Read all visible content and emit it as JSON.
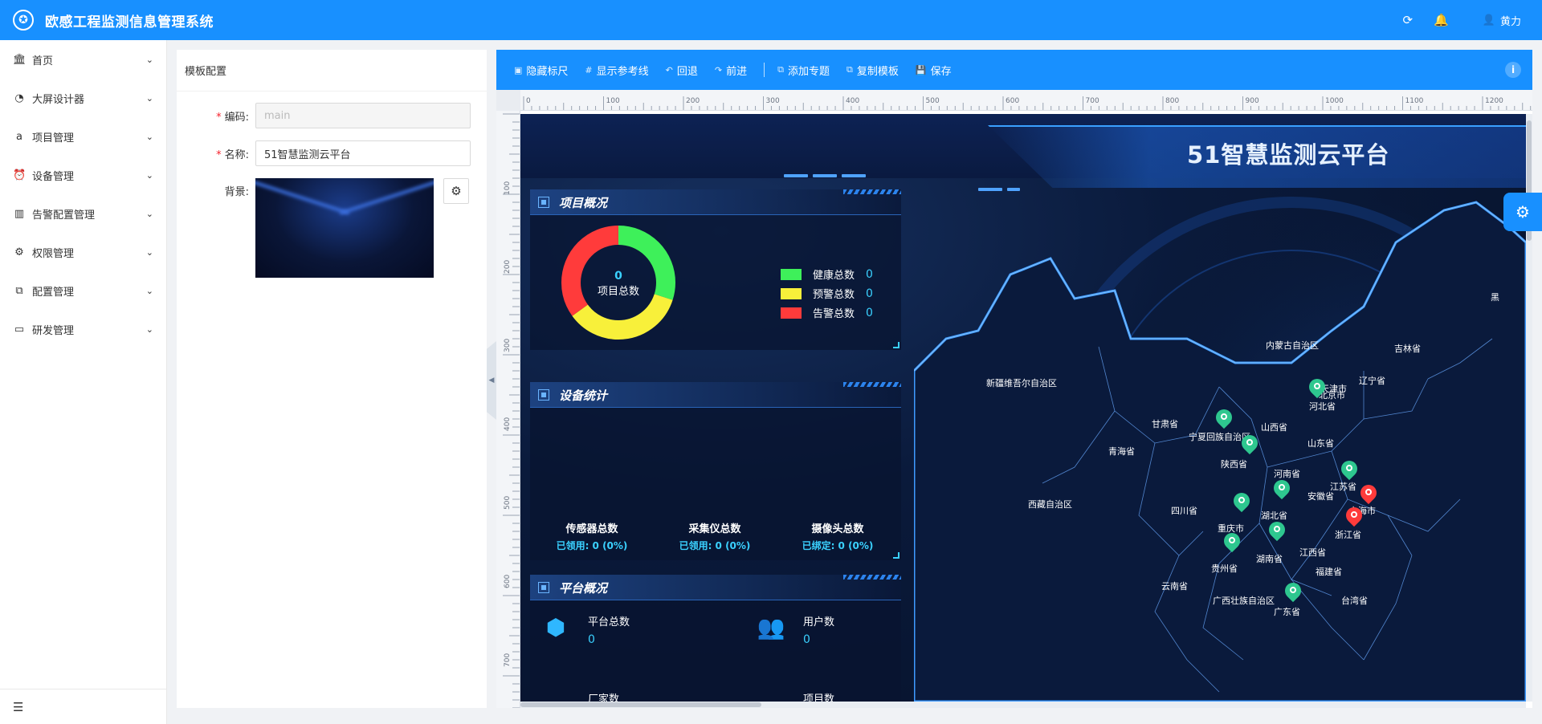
{
  "app": {
    "title": "欧感工程监测信息管理系统",
    "user": "黄力",
    "brand_color": "#1890ff"
  },
  "sidebar": {
    "items": [
      {
        "label": "首页",
        "icon": "bank-icon"
      },
      {
        "label": "大屏设计器",
        "icon": "dashboard-icon"
      },
      {
        "label": "项目管理",
        "icon": "amazon-icon"
      },
      {
        "label": "设备管理",
        "icon": "alarm-icon"
      },
      {
        "label": "告警配置管理",
        "icon": "project-icon"
      },
      {
        "label": "权限管理",
        "icon": "setting-icon"
      },
      {
        "label": "配置管理",
        "icon": "cluster-icon"
      },
      {
        "label": "研发管理",
        "icon": "fund-projection-icon"
      }
    ]
  },
  "config": {
    "header": "模板配置",
    "code_label": "编码:",
    "code_value": "main",
    "name_label": "名称:",
    "name_value": "51智慧监测云平台",
    "bg_label": "背景:"
  },
  "toolbar": {
    "hide_ruler": "隐藏标尺",
    "show_guides": "显示参考线",
    "undo": "回退",
    "redo": "前进",
    "add_topic": "添加专题",
    "copy_template": "复制模板",
    "save": "保存"
  },
  "ruler": {
    "x_ticks": [
      "0",
      "100",
      "200",
      "300",
      "400",
      "500",
      "600",
      "700",
      "800",
      "900",
      "1000",
      "1100",
      "1200"
    ],
    "y_ticks": [
      "100",
      "200",
      "300",
      "400",
      "500",
      "600",
      "700"
    ]
  },
  "canvas": {
    "title": "51智慧监测云平台",
    "project_overview": {
      "title": "项目概况",
      "total_value": "0",
      "total_label": "项目总数",
      "legend": [
        {
          "label": "健康总数",
          "value": "0",
          "color": "#3ef05a"
        },
        {
          "label": "预警总数",
          "value": "0",
          "color": "#f8f03a"
        },
        {
          "label": "告警总数",
          "value": "0",
          "color": "#ff3b3b"
        }
      ]
    },
    "device_stats": {
      "title": "设备统计",
      "items": [
        {
          "name": "传感器总数",
          "sub": "已领用: 0 (0%)"
        },
        {
          "name": "采集仪总数",
          "sub": "已领用: 0 (0%)"
        },
        {
          "name": "摄像头总数",
          "sub": "已绑定: 0 (0%)"
        }
      ]
    },
    "platform_overview": {
      "title": "平台概况",
      "items": [
        {
          "name": "平台总数",
          "value": "0",
          "icon": "box-icon"
        },
        {
          "name": "用户数",
          "value": "0",
          "icon": "users-icon"
        },
        {
          "name": "厂家数",
          "icon": "factory-icon"
        },
        {
          "name": "项目数",
          "icon": "folder-icon"
        }
      ]
    },
    "map": {
      "provinces": [
        "新疆维吾尔自治区",
        "西藏自治区",
        "青海省",
        "甘肃省",
        "内蒙古自治区",
        "宁夏回族自治区",
        "陕西省",
        "山西省",
        "河北省",
        "北京市",
        "山东省",
        "河南省",
        "四川省",
        "重庆市",
        "湖北省",
        "安徽省",
        "江苏省",
        "上海市",
        "浙江省",
        "江西省",
        "湖南省",
        "贵州省",
        "云南省",
        "广西壮族自治区",
        "广东省",
        "福建省",
        "台湾省",
        "辽宁省",
        "吉林省",
        "黑",
        "天津市"
      ],
      "pin_colors": {
        "normal": "#2ec78f",
        "alarm": "#ff3b3b"
      }
    }
  }
}
